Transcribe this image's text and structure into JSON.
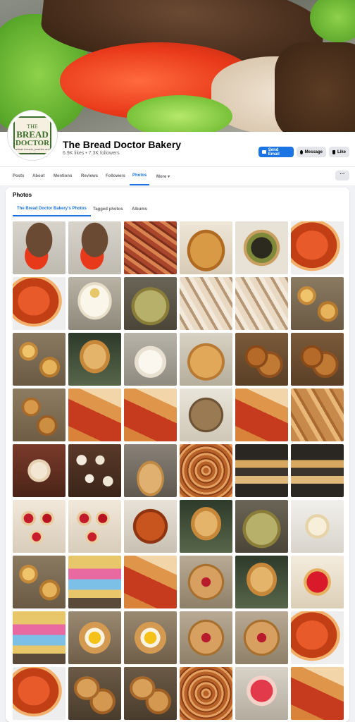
{
  "page": {
    "name": "The Bread Doctor Bakery",
    "stats": "6.9K likes • 7.3K followers",
    "logo": {
      "line1": "THE",
      "line2": "BREAD",
      "line3": "DOCTOR",
      "tagline": "artisan breads, pastries and confections"
    }
  },
  "actions": {
    "send_email": "Send Email",
    "message": "Message",
    "like": "Like"
  },
  "nav": {
    "items": [
      "Posts",
      "About",
      "Mentions",
      "Reviews",
      "Followers",
      "Photos",
      "More ▾"
    ],
    "active": "Photos",
    "more_dots": "···"
  },
  "photos_section": {
    "title": "Photos",
    "tabs": [
      "The Bread Doctor Bakery's Photos",
      "Tagged photos",
      "Albums"
    ],
    "active_tab": "The Bread Doctor Bakery's Photos"
  },
  "colors": {
    "brand_blue": "#1b74e4",
    "bg": "#f0f2f5",
    "secondary_btn": "#e4e6eb"
  },
  "photos": [
    "sandwich",
    "sandwich",
    "bacon-bread",
    "challah",
    "pesto-quiche",
    "pizza-slice",
    "pizza-slice",
    "cupcake",
    "herb-quiche",
    "dinner-rolls",
    "dinner-rolls",
    "quiche-trays",
    "quiche-trays",
    "biscuit-sandwich",
    "meringues",
    "sesame-bun",
    "pretzel-knots",
    "pretzel-knots",
    "pie-trays",
    "stromboli",
    "stromboli",
    "cookie-bag",
    "stromboli",
    "bread-loaves",
    "tiered-cake",
    "cupcake-tray",
    "cookie-stand",
    "cinnamon-rolls",
    "display-case",
    "display-case",
    "jam-tarts",
    "jam-tarts",
    "glazed-ham-bread",
    "biscuit-sandwich",
    "herb-quiche",
    "wedding-cake",
    "quiche-trays",
    "rainbow-cookies",
    "stromboli",
    "cherry-pies",
    "biscuit-sandwich",
    "cherry-tarts",
    "rainbow-cookies",
    "egg-danish",
    "egg-danish",
    "cherry-pies",
    "cherry-pies",
    "pizza-slice",
    "pizza-slice",
    "hand-pies",
    "hand-pies",
    "cinnamon-rolls",
    "cherry-cake",
    "stromboli"
  ]
}
